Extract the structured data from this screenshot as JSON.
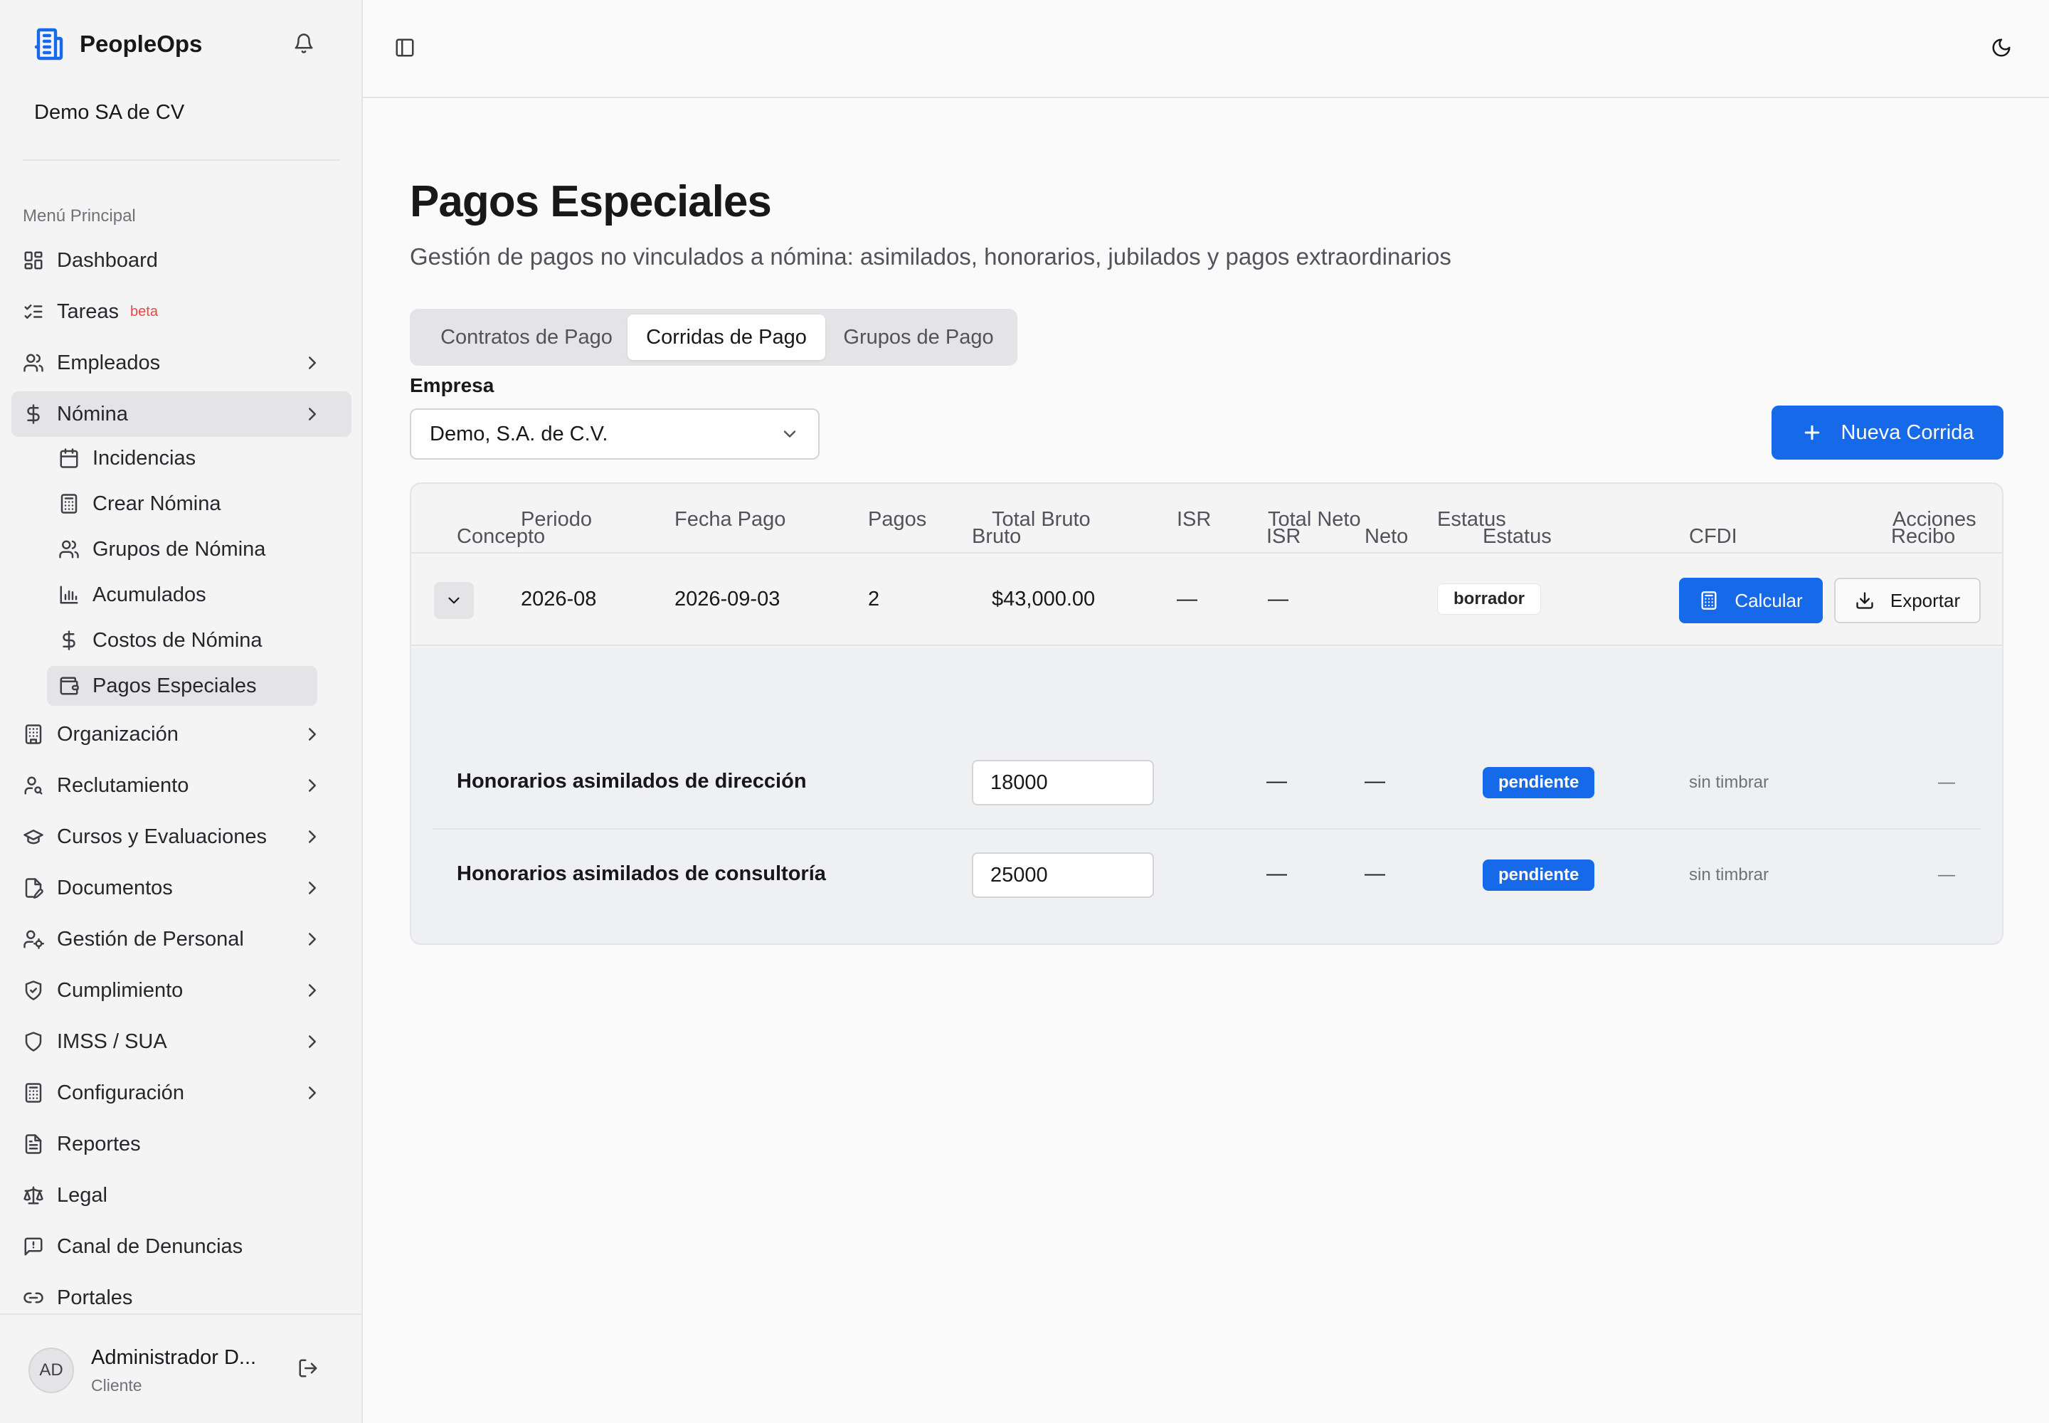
{
  "app": {
    "name": "PeopleOps",
    "company": "Demo SA de CV"
  },
  "sidebar": {
    "section_label": "Menú Principal",
    "items": [
      {
        "label": "Dashboard",
        "icon": "layout-dashboard-icon"
      },
      {
        "label": "Tareas",
        "badge": "beta",
        "icon": "list-checks-icon"
      },
      {
        "label": "Empleados",
        "icon": "users-icon"
      },
      {
        "label": "Nómina",
        "icon": "dollar-sign-icon"
      },
      {
        "label": "Organización",
        "icon": "building-icon"
      },
      {
        "label": "Reclutamiento",
        "icon": "user-search-icon"
      },
      {
        "label": "Cursos y Evaluaciones",
        "icon": "graduation-cap-icon"
      },
      {
        "label": "Documentos",
        "icon": "file-pen-icon"
      },
      {
        "label": "Gestión de Personal",
        "icon": "user-cog-icon"
      },
      {
        "label": "Cumplimiento",
        "icon": "shield-check-icon"
      },
      {
        "label": "IMSS / SUA",
        "icon": "shield-icon"
      },
      {
        "label": "Configuración",
        "icon": "calculator-icon"
      },
      {
        "label": "Reportes",
        "icon": "file-text-icon"
      },
      {
        "label": "Legal",
        "icon": "scale-icon"
      },
      {
        "label": "Canal de Denuncias",
        "icon": "message-square-warning-icon"
      },
      {
        "label": "Portales",
        "icon": "link-icon"
      }
    ],
    "nomina_sub": [
      {
        "label": "Incidencias",
        "icon": "calendar-icon"
      },
      {
        "label": "Crear Nómina",
        "icon": "calculator-icon"
      },
      {
        "label": "Grupos de Nómina",
        "icon": "users-icon"
      },
      {
        "label": "Acumulados",
        "icon": "bar-chart-icon"
      },
      {
        "label": "Costos de Nómina",
        "icon": "dollar-sign-icon"
      },
      {
        "label": "Pagos Especiales",
        "icon": "wallet-icon"
      }
    ]
  },
  "user": {
    "initials": "AD",
    "name": "Administrador D...",
    "role": "Cliente"
  },
  "page": {
    "title": "Pagos Especiales",
    "subtitle": "Gestión de pagos no vinculados a nómina: asimilados, honorarios, jubilados y pagos extraordinarios",
    "tabs": [
      "Contratos de Pago",
      "Corridas de Pago",
      "Grupos de Pago"
    ],
    "active_tab": "Corridas de Pago",
    "empresa_label": "Empresa",
    "empresa_value": "Demo, S.A. de C.V.",
    "new_button": "Nueva Corrida"
  },
  "table": {
    "headers": [
      "Periodo",
      "Fecha Pago",
      "Pagos",
      "Total Bruto",
      "ISR",
      "Total Neto",
      "Estatus",
      "Acciones"
    ],
    "row": {
      "periodo": "2026-08",
      "fecha_pago": "2026-09-03",
      "pagos": "2",
      "total_bruto": "$43,000.00",
      "isr": "—",
      "total_neto": "—",
      "estatus": "borrador",
      "calc_label": "Calcular",
      "export_label": "Exportar"
    },
    "detail_headers": [
      "Concepto",
      "Bruto",
      "ISR",
      "Neto",
      "Estatus",
      "CFDI",
      "Recibo"
    ],
    "detail_rows": [
      {
        "concepto": "Honorarios asimilados de dirección",
        "bruto": "18000",
        "isr": "—",
        "neto": "—",
        "estatus": "pendiente",
        "cfdi": "sin timbrar",
        "recibo": "—"
      },
      {
        "concepto": "Honorarios asimilados de consultoría",
        "bruto": "25000",
        "isr": "—",
        "neto": "—",
        "estatus": "pendiente",
        "cfdi": "sin timbrar",
        "recibo": "—"
      }
    ]
  },
  "colors": {
    "primary": "#1669e8",
    "badge_beta": "#ef4444"
  }
}
